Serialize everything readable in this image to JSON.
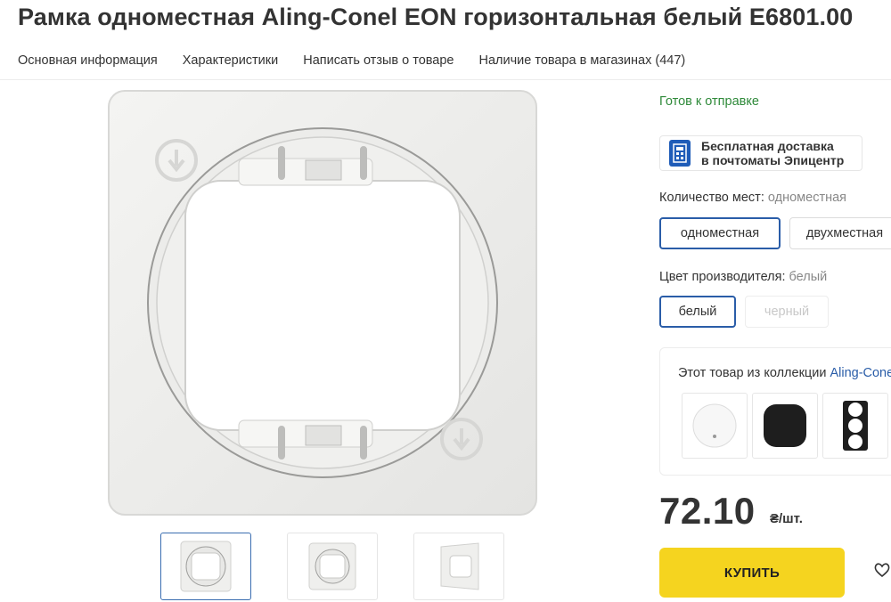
{
  "product": {
    "title": "Рамка одноместная Aling-Conel EON горизонтальная белый E6801.00"
  },
  "tabs": [
    {
      "label": "Основная информация"
    },
    {
      "label": "Характеристики"
    },
    {
      "label": "Написать отзыв о товаре"
    },
    {
      "label": "Наличие товара в магазинах (447)"
    }
  ],
  "gallery": {
    "main_image_icon": "frame-photo",
    "thumbnails": [
      {
        "icon": "frame-thumbnail-front",
        "active": true
      },
      {
        "icon": "frame-thumbnail-angle",
        "active": false
      },
      {
        "icon": "frame-thumbnail-side",
        "active": false
      }
    ]
  },
  "status": {
    "ready": "Готов к отправке"
  },
  "delivery": {
    "line1": "Бесплатная доставка",
    "line2": "в почтоматы Эпицентр",
    "icon": "parcel-locker-icon"
  },
  "options": {
    "places": {
      "label": "Количество мест:",
      "value": "одноместная",
      "choices": [
        "одноместная",
        "двухместная"
      ]
    },
    "color": {
      "label": "Цвет производителя:",
      "value": "белый",
      "choices": [
        "белый",
        "черный"
      ]
    }
  },
  "collection": {
    "text": "Этот товар из коллекции",
    "link": "Aling-Conel EON",
    "items": [
      {
        "icon": "white-switch-icon"
      },
      {
        "icon": "black-switch-icon"
      },
      {
        "icon": "triple-frame-icon"
      }
    ]
  },
  "price": {
    "value": "72.10",
    "unit": "₴/шт."
  },
  "actions": {
    "buy": "КУПИТЬ",
    "favorite_icon": "heart-icon"
  },
  "colors": {
    "accent": "#2a5da8",
    "buy_button": "#f5d41f",
    "ready_green": "#2f8a3a",
    "delivery_icon": "#1f5cb8"
  }
}
